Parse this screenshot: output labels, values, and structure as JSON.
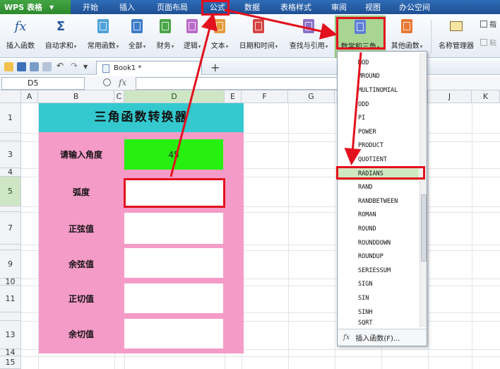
{
  "app": {
    "name": "WPS 表格"
  },
  "menu": {
    "tabs": [
      "开始",
      "插入",
      "页面布局",
      "公式",
      "数据",
      "表格样式",
      "审阅",
      "视图",
      "办公空间"
    ]
  },
  "ribbon": {
    "insert_function": "插入函数",
    "autosum": "自动求和",
    "common": "常用函数",
    "all": "全部",
    "finance": "财务",
    "logic": "逻辑",
    "text": "文本",
    "datetime": "日期和时间",
    "lookup": "查找与引用",
    "math": "数学和三角",
    "other": "其他函数",
    "name_manager": "名称管理器",
    "right1": "指",
    "right2": "粘"
  },
  "toolbar": {
    "doc_tab": "Book1 *",
    "new_tab": "+"
  },
  "formula_bar": {
    "cell_ref": "D5",
    "fx": "fx",
    "value": ""
  },
  "grid": {
    "columns": [
      "A",
      "B",
      "C",
      "D",
      "E",
      "F",
      "G",
      "H",
      "I",
      "J",
      "K"
    ],
    "rows": [
      "1",
      "3",
      "4",
      "5",
      "7",
      "9",
      "10",
      "11",
      "13",
      "14",
      "15"
    ]
  },
  "converter": {
    "title": "三角函数转换器",
    "labels": [
      "请输入角度",
      "弧度",
      "正弦值",
      "余弦值",
      "正切值",
      "余切值"
    ],
    "angle_value": "45"
  },
  "dropdown": {
    "items": [
      "MOD",
      "MROUND",
      "MULTINOMIAL",
      "ODD",
      "PI",
      "POWER",
      "PRODUCT",
      "QUOTIENT",
      "RADIANS",
      "RAND",
      "RANDBETWEEN",
      "ROMAN",
      "ROUND",
      "ROUNDDOWN",
      "ROUNDUP",
      "SERIESSUM",
      "SIGN",
      "SIN",
      "SINH",
      "SQRT"
    ],
    "highlighted": "RADIANS",
    "footer_fx": "fx",
    "footer_label": "插入函数(F)..."
  },
  "colors": {
    "annotation": "#e3101d",
    "title_bg": "#33c9cf",
    "panel_bg": "#f59bc8",
    "angle_bg": "#27f011",
    "highlight": "#cfe8c2"
  }
}
